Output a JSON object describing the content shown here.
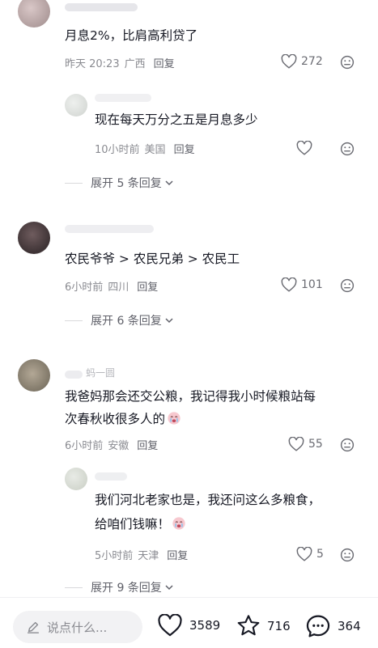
{
  "comments": [
    {
      "text": "月息2%，比肩高利贷了",
      "time": "昨天 20:23",
      "location": "广西",
      "reply": "回复",
      "likes": "272",
      "replies": [
        {
          "text": "现在每天万分之五是月息多少",
          "time": "10小时前",
          "location": "美国",
          "reply": "回复",
          "likes": ""
        }
      ],
      "expand": "展开 5 条回复"
    },
    {
      "text": "农民爷爷 > 农民兄弟 > 农民工",
      "time": "6小时前",
      "location": "四川",
      "reply": "回复",
      "likes": "101",
      "expand": "展开 6 条回复"
    },
    {
      "name_partial": "蚂一圆",
      "text_line1": "我爸妈那会还交公粮，我记得我小时候粮站每",
      "text_line2": "次春秋收很多人的",
      "time": "6小时前",
      "location": "安徽",
      "reply": "回复",
      "likes": "55",
      "replies": [
        {
          "text_line1": "我们河北老家也是，我还问这么多粮食，",
          "text_line2": "给咱们钱嘛！",
          "time": "5小时前",
          "location": "天津",
          "reply": "回复",
          "likes": "5"
        }
      ],
      "expand": "展开 9 条回复"
    }
  ],
  "bottom_bar": {
    "input_placeholder": "说点什么...",
    "likes": "3589",
    "favorites": "716",
    "comments": "364"
  },
  "icons": [
    "heart-outline-icon",
    "neutral-face-icon",
    "chevron-down-icon",
    "pencil-icon",
    "heart-icon",
    "star-icon",
    "comment-bubble-icon",
    "crying-emoji-icon"
  ]
}
